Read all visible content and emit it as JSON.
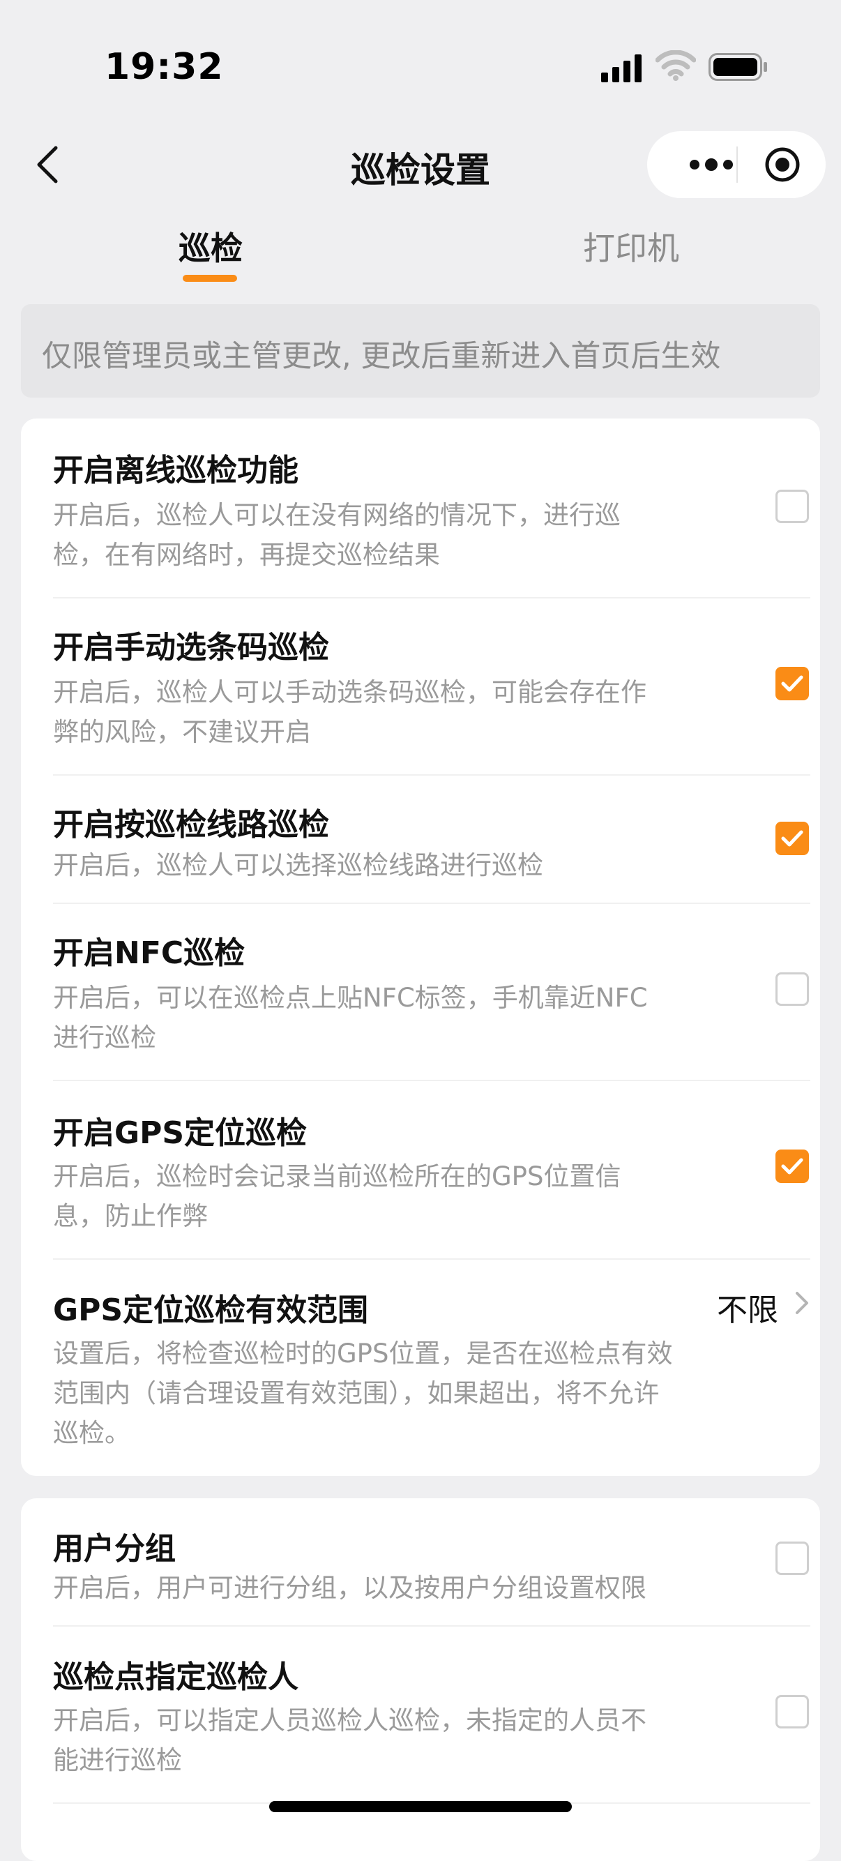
{
  "status_bar": {
    "time": "19:32",
    "icons": [
      "signal-icon",
      "wifi-icon",
      "battery-icon"
    ]
  },
  "nav": {
    "title": "巡检设置",
    "back_icon": "chevron-left-icon",
    "more_icon": "more-dots-icon",
    "target_icon": "target-icon"
  },
  "tabs": [
    {
      "label": "巡检",
      "active": true
    },
    {
      "label": "打印机",
      "active": false
    }
  ],
  "notice": "仅限管理员或主管更改, 更改后重新进入首页后生效",
  "colors": {
    "accent": "#fa8c16",
    "background": "#efeff1",
    "card": "#ffffff",
    "muted_text": "#9a9a9a"
  },
  "settings": [
    {
      "title": "开启离线巡检功能",
      "desc_lines": [
        "开启后，巡检人可以在没有网络的情况下，进行巡",
        "检，在有网络时，再提交巡检结果"
      ],
      "checked": false
    },
    {
      "title": "开启手动选条码巡检",
      "desc_lines": [
        "开启后，巡检人可以手动选条码巡检，可能会存在作",
        "弊的风险，不建议开启"
      ],
      "checked": true
    },
    {
      "title": "开启按巡检线路巡检",
      "desc_lines": [
        "开启后，巡检人可以选择巡检线路进行巡检"
      ],
      "checked": true
    },
    {
      "title": "开启NFC巡检",
      "desc_lines": [
        "开启后，可以在巡检点上贴NFC标签，手机靠近NFC",
        "进行巡检"
      ],
      "checked": false
    },
    {
      "title": "开启GPS定位巡检",
      "desc_lines": [
        "开启后，巡检时会记录当前巡检所在的GPS位置信",
        "息，防止作弊"
      ],
      "checked": true
    },
    {
      "title": "GPS定位巡检有效范围",
      "value": "不限",
      "desc_lines": [
        "设置后，将检查巡检时的GPS位置，是否在巡检点有效",
        "范围内（请合理设置有效范围），如果超出，将不允许",
        "巡检。"
      ]
    }
  ],
  "settings_group_2": [
    {
      "title": "用户分组",
      "desc_lines": [
        "开启后，用户可进行分组，以及按用户分组设置权限"
      ],
      "checked": false
    },
    {
      "title": "巡检点指定巡检人",
      "desc_lines": [
        "开启后，可以指定人员巡检人巡检，未指定的人员不",
        "能进行巡检"
      ],
      "checked": false
    }
  ]
}
